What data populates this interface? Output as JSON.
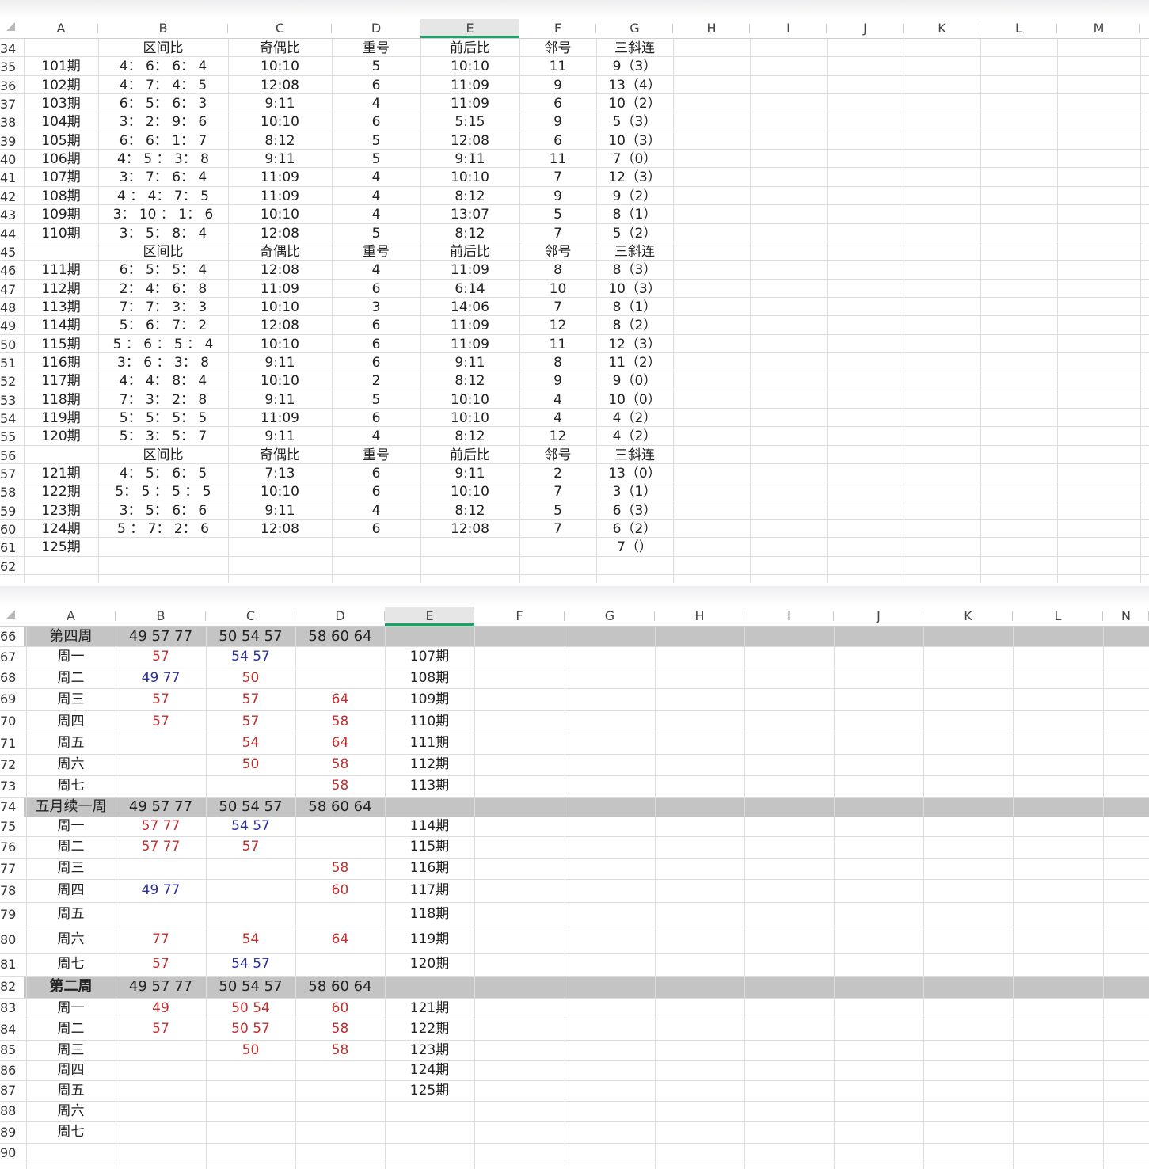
{
  "top_sheet": {
    "columns": [
      "A",
      "B",
      "C",
      "D",
      "E",
      "F",
      "G",
      "H",
      "I",
      "J",
      "K",
      "L",
      "M"
    ],
    "selected_column": "E",
    "rows": [
      {
        "num": "34",
        "cells": [
          "",
          "区间比",
          "奇偶比",
          "重号",
          "前后比",
          "邻号",
          "三斜连"
        ]
      },
      {
        "num": "35",
        "cells": [
          "101期",
          "4： 6： 6： 4",
          "10:10",
          "5",
          "10:10",
          "11",
          "9（3）"
        ]
      },
      {
        "num": "36",
        "cells": [
          "102期",
          "4： 7： 4： 5",
          "12:08",
          "6",
          "11:09",
          "9",
          "13（4）"
        ]
      },
      {
        "num": "37",
        "cells": [
          "103期",
          "6： 5： 6： 3",
          "9:11",
          "4",
          "11:09",
          "6",
          "10（2）"
        ]
      },
      {
        "num": "38",
        "cells": [
          "104期",
          "3： 2： 9： 6",
          "10:10",
          "6",
          "5:15",
          "9",
          "5（3）"
        ]
      },
      {
        "num": "39",
        "cells": [
          "105期",
          "6： 6： 1： 7",
          "8:12",
          "5",
          "12:08",
          "6",
          "10（3）"
        ]
      },
      {
        "num": "40",
        "cells": [
          "106期",
          "4： 5 ： 3： 8",
          "9:11",
          "5",
          "9:11",
          "11",
          "7（0）"
        ]
      },
      {
        "num": "41",
        "cells": [
          "107期",
          "3： 7： 6： 4",
          "11:09",
          "4",
          "10:10",
          "7",
          "12（3）"
        ]
      },
      {
        "num": "42",
        "cells": [
          "108期",
          "4 ： 4： 7： 5",
          "11:09",
          "4",
          "8:12",
          "9",
          "9（2）"
        ]
      },
      {
        "num": "43",
        "cells": [
          "109期",
          "3： 10 ： 1： 6",
          "10:10",
          "4",
          "13:07",
          "5",
          "8（1）"
        ]
      },
      {
        "num": "44",
        "cells": [
          "110期",
          "3： 5： 8： 4",
          "12:08",
          "5",
          "8:12",
          "7",
          "5（2）"
        ]
      },
      {
        "num": "45",
        "cells": [
          "",
          "区间比",
          "奇偶比",
          "重号",
          "前后比",
          "邻号",
          "三斜连"
        ]
      },
      {
        "num": "46",
        "cells": [
          "111期",
          "6： 5： 5： 4",
          "12:08",
          "4",
          "11:09",
          "8",
          "8（3）"
        ]
      },
      {
        "num": "47",
        "cells": [
          "112期",
          "2： 4： 6： 8",
          "11:09",
          "6",
          "6:14",
          "10",
          "10（3）"
        ]
      },
      {
        "num": "48",
        "cells": [
          "113期",
          "7： 7： 3： 3",
          "10:10",
          "3",
          "14:06",
          "7",
          "8（1）"
        ]
      },
      {
        "num": "49",
        "cells": [
          "114期",
          "5： 6： 7： 2",
          "12:08",
          "6",
          "11:09",
          "12",
          "8（2）"
        ]
      },
      {
        "num": "50",
        "cells": [
          "115期",
          "5 ： 6 ： 5 ： 4",
          "10:10",
          "6",
          "11:09",
          "11",
          "12（3）"
        ]
      },
      {
        "num": "51",
        "cells": [
          "116期",
          "3： 6 ： 3： 8",
          "9:11",
          "6",
          "9:11",
          "8",
          "11（2）"
        ]
      },
      {
        "num": "52",
        "cells": [
          "117期",
          "4： 4： 8： 4",
          "10:10",
          "2",
          "8:12",
          "9",
          "9（0）"
        ]
      },
      {
        "num": "53",
        "cells": [
          "118期",
          "7： 3： 2： 8",
          "9:11",
          "5",
          "10:10",
          "4",
          "10（0）"
        ]
      },
      {
        "num": "54",
        "cells": [
          "119期",
          "5： 5： 5： 5",
          "11:09",
          "6",
          "10:10",
          "4",
          "4（2）"
        ]
      },
      {
        "num": "55",
        "cells": [
          "120期",
          "5： 3： 5： 7",
          "9:11",
          "4",
          "8:12",
          "12",
          "4（2）"
        ]
      },
      {
        "num": "56",
        "cells": [
          "",
          "区间比",
          "奇偶比",
          "重号",
          "前后比",
          "邻号",
          "三斜连"
        ]
      },
      {
        "num": "57",
        "cells": [
          "121期",
          "4： 5： 6： 5",
          "7:13",
          "6",
          "9:11",
          "2",
          "13（0）"
        ]
      },
      {
        "num": "58",
        "cells": [
          "122期",
          "5： 5 ： 5 ： 5",
          "10:10",
          "6",
          "10:10",
          "7",
          "3（1）"
        ]
      },
      {
        "num": "59",
        "cells": [
          "123期",
          "3： 5： 6： 6",
          "9:11",
          "4",
          "8:12",
          "5",
          "6（3）"
        ]
      },
      {
        "num": "60",
        "cells": [
          "124期",
          "5 ： 7： 2： 6",
          "12:08",
          "6",
          "12:08",
          "7",
          "6（2）"
        ]
      },
      {
        "num": "61",
        "cells": [
          "125期",
          "",
          "",
          "",
          "",
          "",
          "7（）"
        ]
      },
      {
        "num": "62",
        "cells": [
          "",
          "",
          "",
          "",
          "",
          "",
          ""
        ]
      }
    ]
  },
  "bottom_sheet": {
    "columns": [
      "A",
      "B",
      "C",
      "D",
      "E",
      "F",
      "G",
      "H",
      "I",
      "J",
      "K",
      "L",
      "N"
    ],
    "selected_column": "E",
    "rows": [
      {
        "num": "66",
        "header": true,
        "cells": [
          "第四周",
          "49 57 77",
          "50 54 57",
          "58 60 64",
          ""
        ],
        "color": [
          "",
          "",
          "",
          "",
          ""
        ]
      },
      {
        "num": "67",
        "cells": [
          "周一",
          "57",
          "54 57",
          "",
          "107期"
        ],
        "color": [
          "",
          "red",
          "blue",
          "",
          ""
        ]
      },
      {
        "num": "68",
        "cells": [
          "周二",
          "49 77",
          "50",
          "",
          "108期"
        ],
        "color": [
          "",
          "blue",
          "red",
          "",
          ""
        ]
      },
      {
        "num": "69",
        "cells": [
          "周三",
          "57",
          "57",
          "64",
          "109期"
        ],
        "color": [
          "",
          "red",
          "red",
          "red",
          ""
        ]
      },
      {
        "num": "70",
        "cells": [
          "周四",
          "57",
          "57",
          "58",
          "110期"
        ],
        "color": [
          "",
          "red",
          "red",
          "red",
          ""
        ]
      },
      {
        "num": "71",
        "cells": [
          "周五",
          "",
          "54",
          "64",
          "111期"
        ],
        "color": [
          "",
          "",
          "red",
          "red",
          ""
        ]
      },
      {
        "num": "72",
        "cells": [
          "周六",
          "",
          "50",
          "58",
          "112期"
        ],
        "color": [
          "",
          "",
          "red",
          "red",
          ""
        ]
      },
      {
        "num": "73",
        "cells": [
          "周七",
          "",
          "",
          "58",
          "113期"
        ],
        "color": [
          "",
          "",
          "",
          "red",
          ""
        ]
      },
      {
        "num": "74",
        "header": true,
        "cells": [
          "五月续一周",
          "49 57 77",
          "50 54 57",
          "58 60 64",
          ""
        ],
        "color": [
          "",
          "",
          "",
          "",
          ""
        ]
      },
      {
        "num": "75",
        "cells": [
          "周一",
          "57 77",
          "54 57",
          "",
          "114期"
        ],
        "color": [
          "",
          "red",
          "blue",
          "",
          ""
        ]
      },
      {
        "num": "76",
        "cells": [
          "周二",
          "57 77",
          "57",
          "",
          "115期"
        ],
        "color": [
          "",
          "red",
          "red",
          "",
          ""
        ]
      },
      {
        "num": "77",
        "cells": [
          "周三",
          "",
          "",
          "58",
          "116期"
        ],
        "color": [
          "",
          "",
          "",
          "red",
          ""
        ]
      },
      {
        "num": "78",
        "cells": [
          "周四",
          "49 77",
          "",
          "60",
          "117期"
        ],
        "color": [
          "",
          "blue",
          "",
          "red",
          ""
        ]
      },
      {
        "num": "79",
        "cells": [
          "周五",
          "",
          "",
          "",
          "118期"
        ],
        "color": [
          "",
          "",
          "",
          "",
          ""
        ]
      },
      {
        "num": "80",
        "cells": [
          "周六",
          "77",
          "54",
          "64",
          "119期"
        ],
        "color": [
          "",
          "red",
          "red",
          "red",
          ""
        ]
      },
      {
        "num": "81",
        "cells": [
          "周七",
          "57",
          "54 57",
          "",
          "120期"
        ],
        "color": [
          "",
          "red",
          "blue",
          "",
          ""
        ]
      },
      {
        "num": "82",
        "header": true,
        "bold": true,
        "cells": [
          "第二周",
          "49 57 77",
          "50 54 57",
          "58 60 64",
          ""
        ],
        "color": [
          "",
          "",
          "",
          "",
          ""
        ]
      },
      {
        "num": "83",
        "cells": [
          "周一",
          "49",
          "50 54",
          "60",
          "121期"
        ],
        "color": [
          "",
          "red",
          "red",
          "red",
          ""
        ]
      },
      {
        "num": "84",
        "cells": [
          "周二",
          "57",
          "50 57",
          "58",
          "122期"
        ],
        "color": [
          "",
          "red",
          "red",
          "red",
          ""
        ]
      },
      {
        "num": "85",
        "cells": [
          "周三",
          "",
          "50",
          "58",
          "123期"
        ],
        "color": [
          "",
          "",
          "red",
          "red",
          ""
        ]
      },
      {
        "num": "86",
        "cells": [
          "周四",
          "",
          "",
          "",
          "124期"
        ],
        "color": [
          "",
          "",
          "",
          "",
          ""
        ]
      },
      {
        "num": "87",
        "cells": [
          "周五",
          "",
          "",
          "",
          "125期"
        ],
        "color": [
          "",
          "",
          "",
          "",
          ""
        ]
      },
      {
        "num": "88",
        "cells": [
          "周六",
          "",
          "",
          "",
          ""
        ],
        "color": [
          "",
          "",
          "",
          "",
          ""
        ]
      },
      {
        "num": "89",
        "cells": [
          "周七",
          "",
          "",
          "",
          ""
        ],
        "color": [
          "",
          "",
          "",
          "",
          ""
        ]
      },
      {
        "num": "90",
        "cells": [
          "",
          "",
          "",
          "",
          ""
        ],
        "color": [
          "",
          "",
          "",
          "",
          ""
        ]
      }
    ]
  },
  "colors": {
    "red": "#c0302e",
    "blue": "#2a2fa0",
    "header_gray": "#c4c4c4",
    "selection_green": "#22a06b"
  }
}
